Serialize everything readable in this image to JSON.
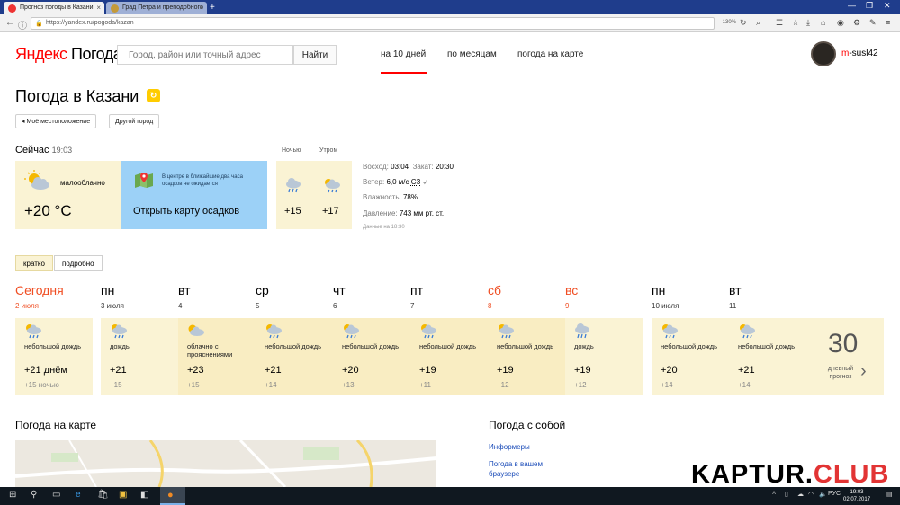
{
  "browser": {
    "tabs": [
      {
        "label": "Прогноз погоды в Казани",
        "active": true
      },
      {
        "label": "Град Петра и преподобного",
        "active": false
      }
    ],
    "url": "https://yandex.ru/pogoda/kazan",
    "zoom": "130%"
  },
  "header": {
    "logo_brand": "Яндекс",
    "logo_service": "Погода",
    "search_placeholder": "Город, район или точный адрес",
    "search_button": "Найти",
    "nav": [
      "на 10 дней",
      "по месяцам",
      "погода на карте"
    ],
    "user_first": "m",
    "user_rest": "-susl42"
  },
  "title": {
    "text": "Погода в Казани",
    "my_location": "Моё местоположение",
    "other_city": "Другой город"
  },
  "now": {
    "label": "Сейчас",
    "time": "19:03",
    "condition": "малооблачно",
    "temp": "+20 °C",
    "map_text": "В центре в ближайшие два часа осадков не ожидается",
    "map_link": "Открыть карту осадков",
    "parts": [
      {
        "label": "Ночью",
        "temp": "+15"
      },
      {
        "label": "Утром",
        "temp": "+17"
      }
    ],
    "details": {
      "sunrise_label": "Восход:",
      "sunrise": "03:04",
      "sunset_label": "Закат:",
      "sunset": "20:30",
      "wind_label": "Ветер:",
      "wind": "6,0 м/с",
      "wind_dir": "СЗ",
      "humidity_label": "Влажность:",
      "humidity": "78%",
      "pressure_label": "Давление:",
      "pressure": "743 мм рт. ст.",
      "data_time": "Данные на 18:30"
    }
  },
  "mode": {
    "short": "кратко",
    "detailed": "подробно"
  },
  "forecast": [
    {
      "day": "Сегодня",
      "date": "2 июля",
      "weekend": true,
      "icon": "cloud-rain-sun-icon",
      "desc": "небольшой дождь",
      "day_temp": "+21 днём",
      "night_temp": "+15 ночью"
    },
    {
      "day": "пн",
      "date": "3 июля",
      "weekend": false,
      "icon": "cloud-rain-sun-icon",
      "desc": "дождь",
      "day_temp": "+21",
      "night_temp": "+15"
    },
    {
      "day": "вт",
      "date": "4",
      "weekend": false,
      "icon": "cloud-sun-icon",
      "desc": "облачно с прояснениями",
      "day_temp": "+23",
      "night_temp": "+15"
    },
    {
      "day": "ср",
      "date": "5",
      "weekend": false,
      "icon": "cloud-rain-sun-icon",
      "desc": "небольшой дождь",
      "day_temp": "+21",
      "night_temp": "+14"
    },
    {
      "day": "чт",
      "date": "6",
      "weekend": false,
      "icon": "cloud-rain-sun-icon",
      "desc": "небольшой дождь",
      "day_temp": "+20",
      "night_temp": "+13"
    },
    {
      "day": "пт",
      "date": "7",
      "weekend": false,
      "icon": "cloud-rain-sun-icon",
      "desc": "небольшой дождь",
      "day_temp": "+19",
      "night_temp": "+11"
    },
    {
      "day": "сб",
      "date": "8",
      "weekend": true,
      "icon": "cloud-rain-sun-icon",
      "desc": "небольшой дождь",
      "day_temp": "+19",
      "night_temp": "+12"
    },
    {
      "day": "вс",
      "date": "9",
      "weekend": true,
      "icon": "cloud-rain-icon",
      "desc": "дождь",
      "day_temp": "+19",
      "night_temp": "+12"
    },
    {
      "day": "пн",
      "date": "10 июля",
      "weekend": false,
      "icon": "cloud-rain-sun-icon",
      "desc": "небольшой дождь",
      "day_temp": "+20",
      "night_temp": "+14"
    },
    {
      "day": "вт",
      "date": "11",
      "weekend": false,
      "icon": "cloud-rain-sun-icon",
      "desc": "небольшой дождь",
      "day_temp": "+21",
      "night_temp": "+14"
    }
  ],
  "promo": {
    "number": "30",
    "text": "дневный прогноз"
  },
  "sections": {
    "map_title": "Погода на карте",
    "with_you_title": "Погода с собой",
    "links": [
      "Информеры",
      "Погода в вашем браузере"
    ]
  },
  "watermark": {
    "main": "KAPTUR.",
    "accent": "CLUB"
  },
  "taskbar": {
    "lang": "РУС",
    "time": "19:03",
    "date": "02.07.2017"
  },
  "colors": {
    "accent_red": "#f00",
    "card_bg": "#faf3d4",
    "map_card_bg": "#9cd1f7",
    "weekend": "#f04e23",
    "link": "#1a4bb8"
  }
}
